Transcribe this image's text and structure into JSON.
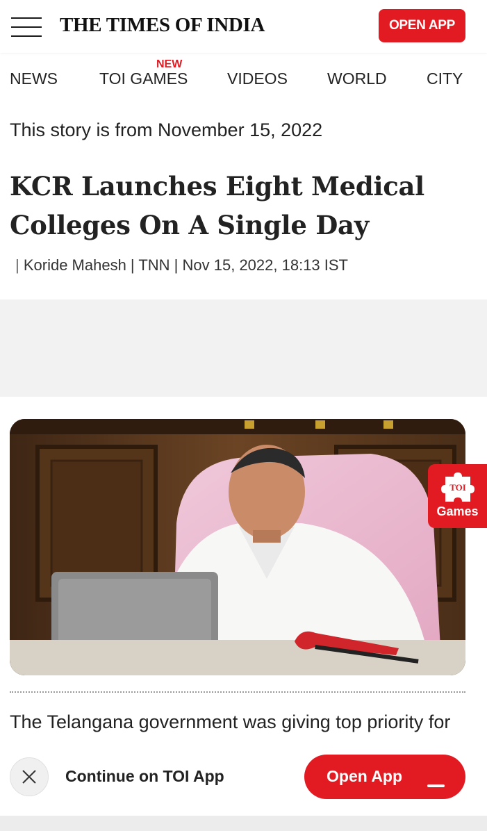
{
  "header": {
    "logo": "THE TIMES OF INDIA",
    "open_app_label": "OPEN APP",
    "menu_icon": "hamburger-menu-icon"
  },
  "nav": {
    "new_badge": "NEW",
    "items": [
      "NEWS",
      "TOI GAMES",
      "VIDEOS",
      "WORLD",
      "CITY"
    ]
  },
  "article": {
    "story_date": "This story is from November 15, 2022",
    "headline": "KCR Launches Eight Medical Colleges On A Single Day",
    "byline_prefix": "|",
    "byline": "Koride Mahesh | TNN | Nov 15, 2022, 18:13 IST",
    "first_paragraph": "The Telangana government was giving top priority for"
  },
  "games_badge": {
    "icon_text": "TOI",
    "label": "Games"
  },
  "bottom_bar": {
    "continue_label": "Continue on TOI App",
    "open_app_label": "Open App",
    "close_icon": "close-icon"
  },
  "colors": {
    "brand_red": "#e21b22",
    "text": "#222222",
    "ad_background": "#f2f2f2"
  }
}
